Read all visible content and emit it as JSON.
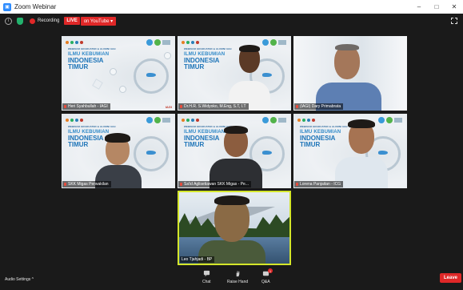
{
  "window": {
    "title": "Zoom Webinar",
    "minimize": "–",
    "maximize": "□",
    "close": "✕"
  },
  "topbar": {
    "recording_label": "Recording",
    "live_label": "LIVE",
    "live_destination": "on YouTube ▾",
    "info_icon": "i"
  },
  "banner": {
    "header": "WEBINAR GRADUATED & ALUMNI IAGI",
    "line1": "ILMU KEBUMIAN",
    "line2": "INDONESIA",
    "line3": "TIMUR",
    "corner_label": "IAGI"
  },
  "participants": [
    {
      "name": "Heri Syahbullah - IAGI",
      "type": "banner"
    },
    {
      "name": "Dr.H.R. S.Widyoko, M.Eng, S.T, I.T",
      "type": "banner-person"
    },
    {
      "name": "(IAGI) Dary Primabrata",
      "type": "person"
    },
    {
      "name": "SKK Migas Perwakilan",
      "type": "banner-person"
    },
    {
      "name": "Sa'id Aglisetiawan SKK Migas - Pe...",
      "type": "banner-person"
    },
    {
      "name": "Lorena Panjaitan - ICG",
      "type": "banner-person"
    },
    {
      "name": "Leo Tjahjadi - BP",
      "type": "person-scenic"
    }
  ],
  "toolbar": {
    "audio_settings": "Audio Settings ^",
    "chat": "Chat",
    "raise_hand": "Raise Hand",
    "qa": "Q&A",
    "qa_count": "1",
    "leave": "Leave"
  },
  "colors": {
    "live_red": "#e02828",
    "brand_blue": "#2d8cff",
    "banner_blue": "#1d74b8"
  }
}
